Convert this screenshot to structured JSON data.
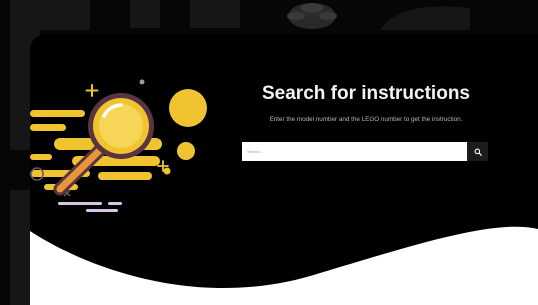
{
  "hero": {
    "title": "Search for instructions",
    "subtitle": "Enter the model number and the LEGO number to get the instruction."
  },
  "search": {
    "placeholder": "Search ...",
    "value": "",
    "button_icon": "search-icon"
  },
  "colors": {
    "background": "#060606",
    "panel": "#000000",
    "accent_yellow": "#f0c330",
    "magnifier_handle": "#e8963b",
    "magnifier_frame": "#5a3540",
    "wave": "#ffffff",
    "search_button": "#1c1c1c"
  }
}
